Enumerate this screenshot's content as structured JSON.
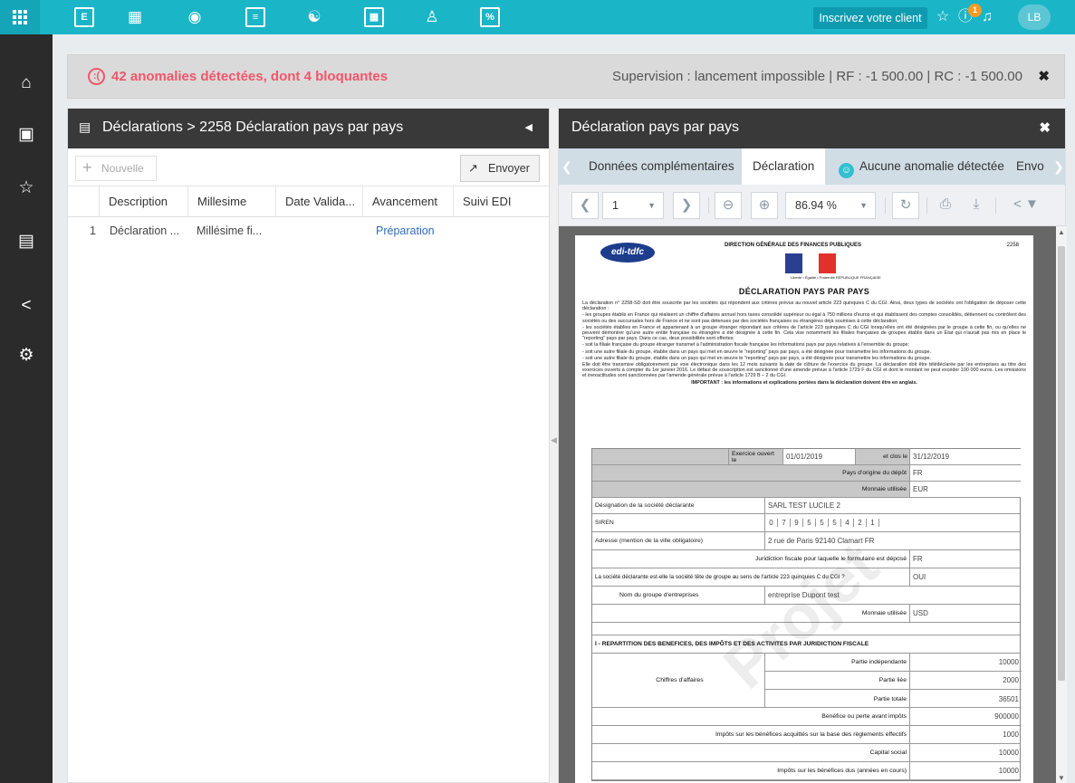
{
  "topbar": {
    "invite_label": "Inscrivez votre client",
    "avatar_initials": "LB",
    "notification_count": "1",
    "nav_icons": [
      "ledger-icon",
      "org-chart-icon",
      "money-icon",
      "calculator-icon",
      "hand-coins-icon",
      "building-icon",
      "user-signature-icon",
      "percent-doc-icon"
    ]
  },
  "sidebar": {
    "icons": [
      "home-icon",
      "window-icon",
      "star-icon",
      "chart-doc-icon",
      "share-icon",
      "settings-icon"
    ]
  },
  "banner": {
    "anomalies": "42 anomalies détectées, dont 4 bloquantes",
    "supervision": "Supervision : lancement impossible | RF : -1 500.00 | RC : -1 500.00"
  },
  "left_panel": {
    "title": "Déclarations > 2258 Déclaration pays par pays",
    "new_label": "Nouvelle",
    "send_label": "Envoyer",
    "columns": [
      "Description",
      "Millesime",
      "Date Valida...",
      "Avancement",
      "Suivi EDI"
    ],
    "rows": [
      {
        "num": "1",
        "description": "Déclaration ...",
        "millesime": "Millésime fi...",
        "date": "",
        "avancement": "Préparation",
        "suivi": ""
      }
    ]
  },
  "right_panel": {
    "title": "Déclaration pays par pays",
    "tabs": [
      "Données complémentaires",
      "Déclaration",
      "Aucune anomalie détectée",
      "Envo"
    ],
    "active_tab": "Déclaration",
    "page_number": "1",
    "zoom": "86.94 %"
  },
  "document": {
    "logo": "edi-tdfc",
    "agency": "DIRECTION GÉNÉRALE DES FINANCES PUBLIQUES",
    "form_number": "2258",
    "republic": "Liberté • Égalité • Fraternité RÉPUBLIQUE FRANÇAISE",
    "title": "DÉCLARATION PAYS PAR PAYS",
    "intro": "La déclaration n° 2258-SD doit être souscrite par les sociétés qui répondent aux critères prévus au nouvel article 223 quinquies C du CGI. Ainsi, deux types de sociétés ont l'obligation de déposer cette déclaration :",
    "bullets": [
      "- les groupes établis en France qui réalisent un chiffre d'affaires annuel hors taxes consolidé supérieur ou égal à 750 millions d'euros et qui établissent des comptes consolidés, détiennent ou contrôlent des sociétés ou des succursales hors de France et ne sont pas détenues par des sociétés françaises ou étrangères déjà soumises à cette déclaration;",
      "- les sociétés établies en France et appartenant à un groupe étranger répondant aux critères de l'article 223 quinquies C du CGI lorsqu'elles ont été désignées par le groupe à cette fin, ou qu'elles ne peuvent démontrer qu'une autre entité française ou étrangère a été désignée à cette fin. Cela vise notamment les filiales françaises de groupes établis dans un État qui n'aurait pas mis en place le \"reporting\" pays par pays. Dans ce cas, deux possibilités sont offertes:",
      "- soit la filiale française du groupe étranger transmet à l'administration fiscale française les informations pays par pays relatives à l'ensemble du groupe;",
      "- soit une autre filiale du groupe, établie dans un pays qui met en œuvre le \"reporting\" pays par pays, a été désignée pour transmettre les informations du groupe.",
      "- soit une autre filiale du groupe, établie dans un pays qui met en œuvre le \"reporting\" pays par pays, a été désignée pour transmettre les informations du groupe.",
      "Elle doit être transmise obligatoirement par voie électronique dans les 12 mois suivants la date de clôture de l'exercice du groupe. La déclaration doit être télédéclarée par les entreprises au titre des exercices ouverts à compter du 1er janvier 2016. Le défaut de souscription est sanctionné d'une amende prévue à l'article 1729 F du CGI et dont le montant ne peut excéder 100 000 euros. Les omissions et inexactitudes sont sanctionnées par l'amende générale prévue à l'article 1729 B – 2 du CGI."
    ],
    "important": "IMPORTANT : les informations et explications portées dans la déclaration doivent être en anglais.",
    "form": {
      "exercice_label": "Exercice ouvert le",
      "exercice_start": "01/01/2019",
      "clos_label": "et clos le",
      "exercice_end": "31/12/2019",
      "pays_label": "Pays d'origine du dépôt",
      "pays": "FR",
      "monnaie_label": "Monnaie utilisée",
      "monnaie": "EUR",
      "designation_label": "Désignation de la société déclarante",
      "designation": "SARL TEST LUCILE 2",
      "siren_label": "SIREN",
      "siren_digits": [
        "0",
        "7",
        "9",
        "5",
        "5",
        "5",
        "4",
        "2",
        "1"
      ],
      "adresse_label": "Adresse (mention de la ville obligatoire)",
      "adresse": "2 rue de Paris 92140 Clamart FR",
      "juridiction_label": "Juridiction fiscale pour laquelle le formulaire est déposé",
      "juridiction": "FR",
      "tete_label": "La société déclarante est-elle la société tête de groupe au sens de l'article 223 quinquies C du CGI ?",
      "tete": "OUI",
      "groupe_label": "Nom du groupe d'entreprises",
      "groupe": "entreprise Dupont test",
      "monnaie2_label": "Monnaie utilisée",
      "monnaie2": "USD",
      "section1": "I - REPARTITION DES BENEFICES, DES IMPÔTS ET DES ACTIVITES PAR JURIDICTION FISCALE",
      "ca_label": "Chiffres d'affaires",
      "ca_rows": [
        {
          "label": "Partie indépendante",
          "value": "10000"
        },
        {
          "label": "Partie liée",
          "value": "2000"
        },
        {
          "label": "Partie totale",
          "value": "36501"
        }
      ],
      "other_rows": [
        {
          "label": "Bénéfice ou perte avant impôts",
          "value": "900000"
        },
        {
          "label": "Impôts sur les bénéfices acquittés sur la base des règlements effectifs",
          "value": "1000"
        },
        {
          "label": "Capital social",
          "value": "10000"
        },
        {
          "label": "Impôts sur les bénéfices dus (années en cours)",
          "value": "10000"
        }
      ]
    },
    "watermark": "Projet"
  }
}
